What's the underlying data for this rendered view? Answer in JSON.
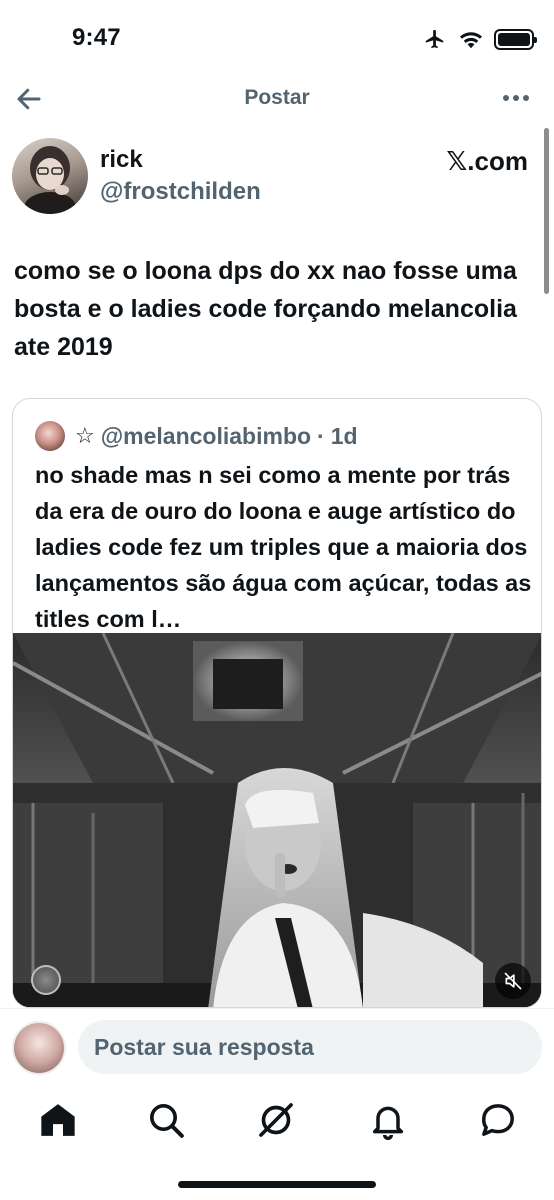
{
  "status_bar": {
    "time": "9:47",
    "icons": [
      "airplane-icon",
      "wifi-icon",
      "battery-icon"
    ]
  },
  "nav": {
    "title": "Postar",
    "back_icon": "arrow-left-icon",
    "more_icon": "more-horizontal-icon"
  },
  "tweet": {
    "author_name": "rick",
    "author_handle": "@frostchilden",
    "site_label": "𝕏.com",
    "text": "como se o loona dps do xx nao fosse uma bosta e o ladies code forçando melancolia ate 2019"
  },
  "quote": {
    "star": "☆",
    "handle": "@melancoliabimbo",
    "separator": "·",
    "time": "1d",
    "text": "no shade mas n sei como a mente por trás da era de ouro do loona e auge artístico do ladies code fez um triples que a maioria dos lançamentos são água com açúcar, todas as titles com l…",
    "media": {
      "kind": "video",
      "mute_icon": "volume-muted-icon"
    }
  },
  "reply": {
    "placeholder": "Postar sua resposta"
  },
  "tab_bar": {
    "items": [
      {
        "name": "home",
        "icon": "home-icon",
        "active": true
      },
      {
        "name": "search",
        "icon": "search-icon",
        "active": false
      },
      {
        "name": "grok",
        "icon": "grok-icon",
        "active": false
      },
      {
        "name": "notifications",
        "icon": "bell-icon",
        "active": false
      },
      {
        "name": "messages",
        "icon": "message-icon",
        "active": false
      }
    ]
  },
  "colors": {
    "text_primary": "#0f1419",
    "text_secondary": "#536471",
    "border": "#cfd9de",
    "input_bg": "#eff3f4"
  }
}
